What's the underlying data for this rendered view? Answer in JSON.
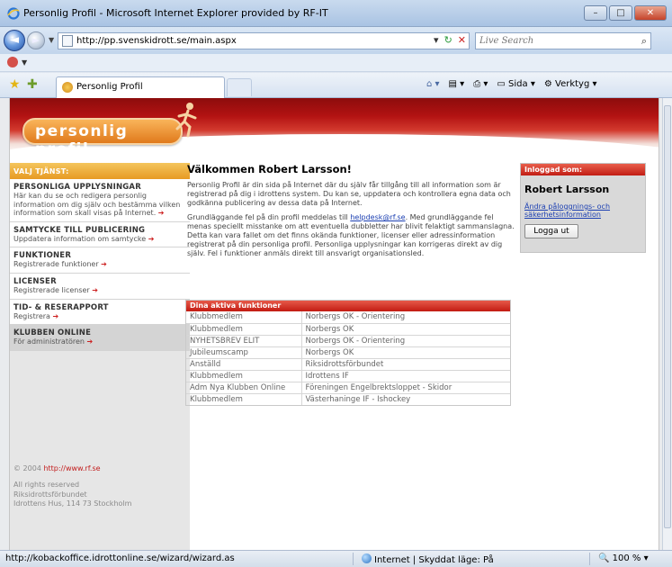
{
  "window": {
    "title": "Personlig Profil - Microsoft Internet Explorer provided by RF-IT",
    "minimize": "–",
    "maximize": "□",
    "close": "✕"
  },
  "nav": {
    "back": "◄",
    "forward": "►",
    "address": "http://pp.svenskidrott.se/main.aspx",
    "search_placeholder": "Live Search"
  },
  "tabs": {
    "active_label": "Personlig Profil"
  },
  "commandbar": {
    "page": "Sida",
    "tools": "Verktyg"
  },
  "logo": {
    "text": "personlig profil"
  },
  "leftnav": {
    "heading": "VALJ TJÄNST:",
    "items": [
      {
        "title": "PERSONLIGA UPPLYSNINGAR",
        "sub": "Här kan du se och redigera personlig information om dig själv och bestämma vilken information som skall visas på Internet."
      },
      {
        "title": "SAMTYCKE TILL PUBLICERING",
        "sub": "Uppdatera information om samtycke"
      },
      {
        "title": "FUNKTIONER",
        "sub": "Registrerade funktioner"
      },
      {
        "title": "LICENSER",
        "sub": "Registrerade licenser"
      },
      {
        "title": "TID- & RESERAPPORT",
        "sub": "Registrera"
      },
      {
        "title": "KLUBBEN ONLINE",
        "sub": "För administratören"
      }
    ],
    "footer": {
      "copyright": "© 2004",
      "link": "http://www.rf.se",
      "rights": "All rights reserved",
      "org": "Riksidrottsförbundet",
      "address": "Idrottens Hus, 114 73 Stockholm"
    }
  },
  "main": {
    "heading": "Välkommen Robert Larsson!",
    "para1": "Personlig Profil är din sida på Internet där du själv får tillgång till all information som är registrerad på dig i idrottens system. Du kan se, uppdatera och kontrollera egna data och godkänna publicering av dessa data på Internet.",
    "para2_before": "Grundläggande fel på din profil meddelas till ",
    "para2_link": "helpdesk@rf.se",
    "para2_after": ". Med grundläggande fel menas speciellt misstanke om att eventuella dubbletter har blivit felaktigt sammanslagna. Detta kan vara fallet om det finns okända funktioner, licenser eller adressinformation registrerat på din personliga profil. Personliga upplysningar kan korrigeras direkt av dig själv. Fel i funktioner anmäls direkt till ansvarigt organisationsled."
  },
  "functions": {
    "heading": "Dina aktiva funktioner",
    "rows": [
      [
        "Klubbmedlem",
        "Norbergs OK - Orientering"
      ],
      [
        "Klubbmedlem",
        "Norbergs OK"
      ],
      [
        "NYHETSBREV ELIT",
        "Norbergs OK - Orientering"
      ],
      [
        "Jubileumscamp",
        "Norbergs OK"
      ],
      [
        "Anställd",
        "Riksidrottsförbundet"
      ],
      [
        "Klubbmedlem",
        "Idrottens IF"
      ],
      [
        "Adm Nya Klubben Online",
        "Föreningen Engelbrektsloppet - Skidor"
      ],
      [
        "Klubbmedlem",
        "Västerhaninge IF - Ishockey"
      ]
    ]
  },
  "login": {
    "heading": "Inloggad som:",
    "name": "Robert Larsson",
    "link": "Ändra påloggnings- och säkerhetsinformation",
    "logout": "Logga ut"
  },
  "status": {
    "url": "http://kobackoffice.idrottonline.se/wizard/wizard.as",
    "zone": "Internet | Skyddat läge: På",
    "zoom": "100 %"
  },
  "colors": {
    "banner_red": "#b31212",
    "logo_orange": "#e07a1c",
    "nav_header": "#e79a23",
    "panel_red": "#c21b12",
    "link_blue": "#1b3fb2"
  }
}
